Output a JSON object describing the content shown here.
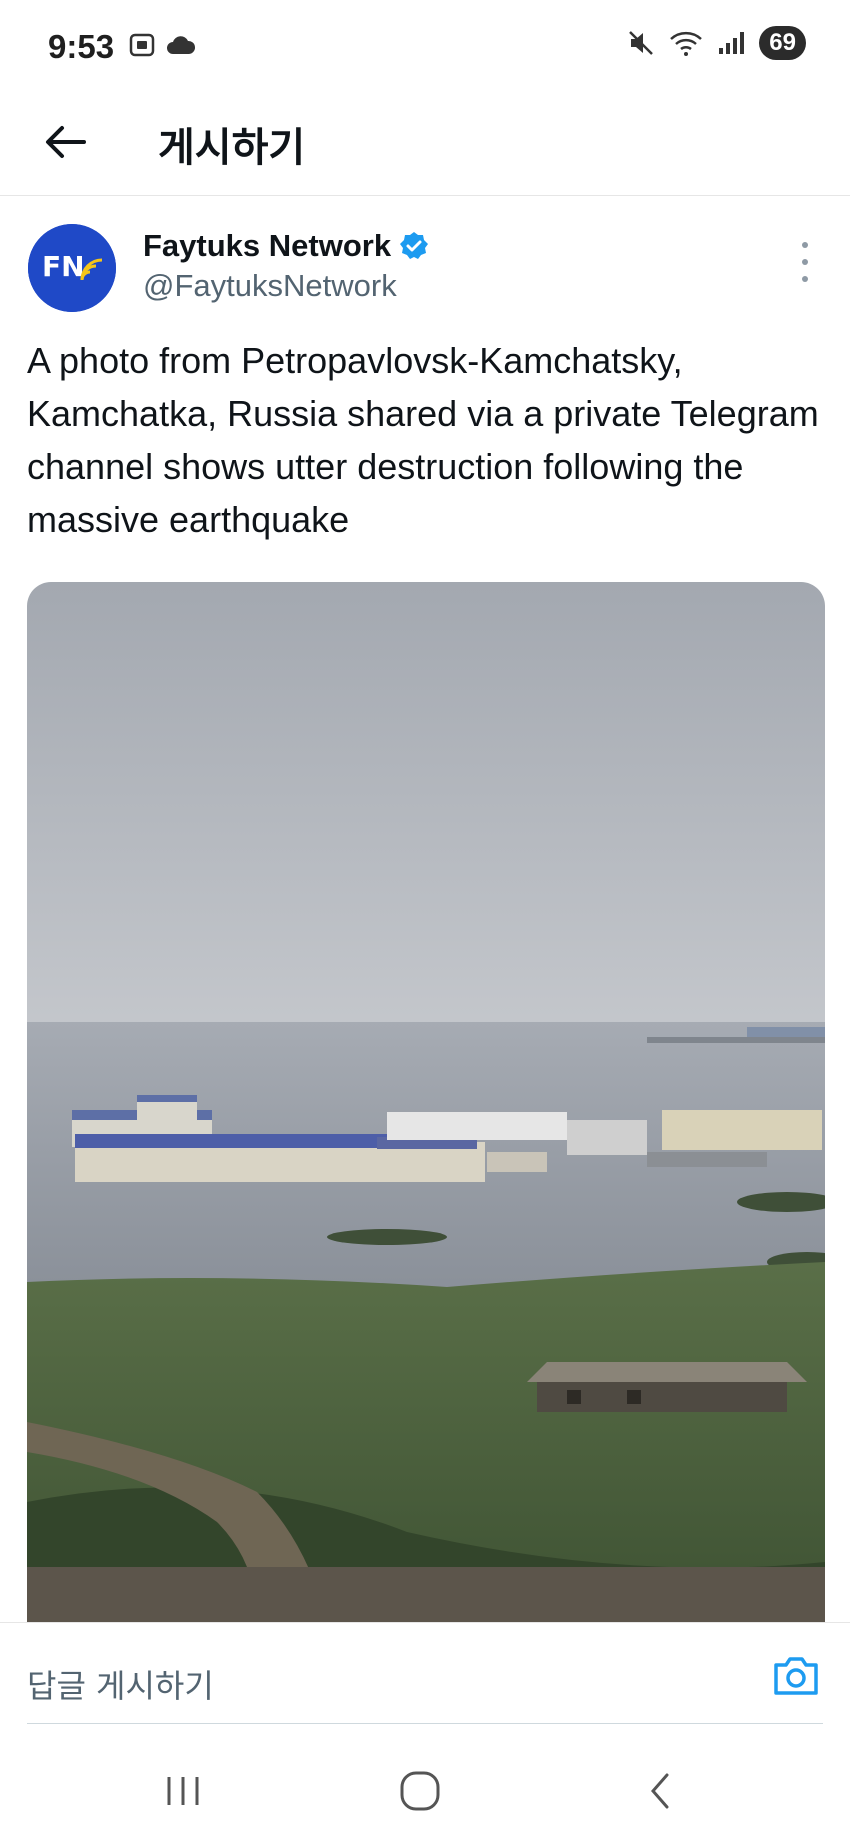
{
  "status_bar": {
    "time": "9:53",
    "battery": "69",
    "icons": [
      "screenshot-icon",
      "cloud-icon",
      "mute-icon",
      "wifi-icon",
      "signal-icon"
    ]
  },
  "header": {
    "title": "게시하기",
    "back_icon": "arrow-left-icon"
  },
  "tweet": {
    "author_name": "Faytuks Network",
    "verified": true,
    "handle": "@FaytuksNetwork",
    "avatar_text": "FN",
    "text": "A photo from Petropavlovsk-Kamchatsky, Kamchatka, Russia shared via a private Telegram channel shows utter destruction following the massive earthquake"
  },
  "reply": {
    "placeholder": "답글 게시하기"
  },
  "colors": {
    "accent": "#1d9bf0",
    "text": "#0f1419",
    "secondary": "#536471"
  }
}
